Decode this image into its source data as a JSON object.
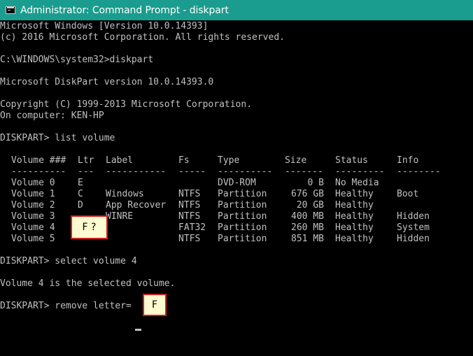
{
  "window": {
    "title": "Administrator: Command Prompt - diskpart"
  },
  "console": {
    "lines": [
      "Microsoft Windows [Version 10.0.14393]",
      "(c) 2016 Microsoft Corporation. All rights reserved.",
      "C:\\WINDOWS\\system32>diskpart",
      "Microsoft DiskPart version 10.0.14393.0",
      "Copyright (C) 1999-2013 Microsoft Corporation.",
      "On computer: KEN-HP",
      "DISKPART> list volume",
      "DISKPART> select volume 4",
      "Volume 4 is the selected volume.",
      "DISKPART> remove letter="
    ],
    "table": {
      "headers": [
        "Volume ###",
        "Ltr",
        "Label",
        "Fs",
        "Type",
        "Size",
        "Status",
        "Info"
      ],
      "separators": [
        "----------",
        "---",
        "-----------",
        "-----",
        "----------",
        "-------",
        "---------",
        "--------"
      ],
      "rows": [
        [
          "Volume 0",
          "E",
          "",
          "",
          "DVD-ROM",
          "0 B",
          "No Media",
          ""
        ],
        [
          "Volume 1",
          "C",
          "Windows",
          "NTFS",
          "Partition",
          "676 GB",
          "Healthy",
          "Boot"
        ],
        [
          "Volume 2",
          "D",
          "App Recover",
          "NTFS",
          "Partition",
          "20 GB",
          "Healthy",
          ""
        ],
        [
          "Volume 3",
          "",
          "WINRE",
          "NTFS",
          "Partition",
          "400 MB",
          "Healthy",
          "Hidden"
        ],
        [
          "Volume 4",
          "",
          "",
          "FAT32",
          "Partition",
          "260 MB",
          "Healthy",
          "System"
        ],
        [
          "Volume 5",
          "",
          "",
          "NTFS",
          "Partition",
          "851 MB",
          "Healthy",
          "Hidden"
        ]
      ]
    }
  },
  "annotations": {
    "ltr_note": "F ?",
    "letter_note": "F"
  }
}
